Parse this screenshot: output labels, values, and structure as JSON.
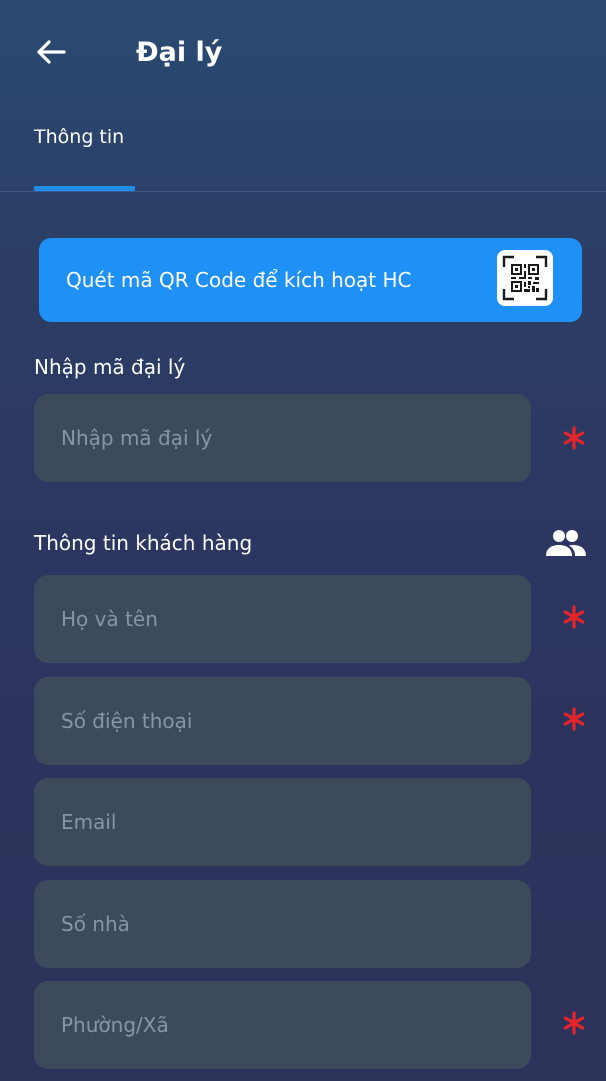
{
  "header": {
    "title": "Đại lý",
    "back_icon": "arrow-left-icon"
  },
  "tabs": [
    {
      "label": "Thông tin",
      "active": true
    }
  ],
  "qr_button": {
    "label": "Quét mã QR Code để kích hoạt HC",
    "icon": "qr-code-icon"
  },
  "agent_section": {
    "label": "Nhập mã đại lý",
    "field": {
      "placeholder": "Nhập mã đại lý",
      "value": "",
      "required": true
    }
  },
  "customer_section": {
    "label": "Thông tin khách hàng",
    "icon": "people-icon",
    "fields": [
      {
        "placeholder": "Họ và tên",
        "value": "",
        "required": true
      },
      {
        "placeholder": "Số điện thoại",
        "value": "",
        "required": true
      },
      {
        "placeholder": "Email",
        "value": "",
        "required": false
      },
      {
        "placeholder": "Số nhà",
        "value": "",
        "required": false
      },
      {
        "placeholder": "Phường/Xã",
        "value": "",
        "required": true
      }
    ]
  },
  "colors": {
    "accent": "#1e90f6",
    "field_bg": "#3c4a5c",
    "required_marker": "#e8242a",
    "background_top": "#2a4a72",
    "background_bottom": "#2c3259"
  }
}
